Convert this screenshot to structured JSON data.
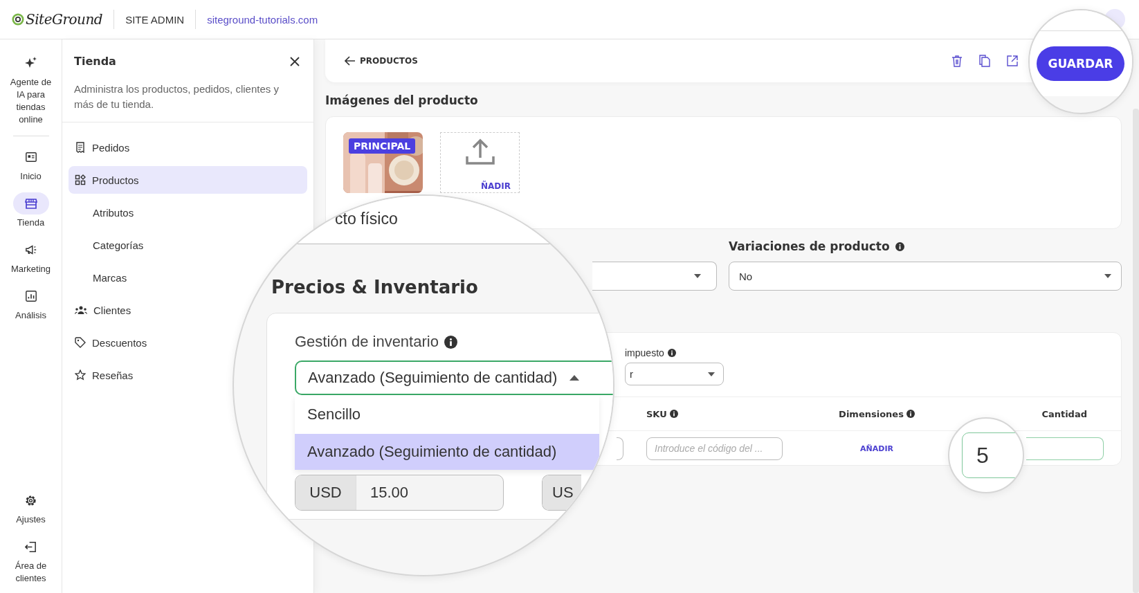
{
  "topbar": {
    "logo": "SiteGround",
    "section": "SITE ADMIN",
    "domain": "siteground-tutorials.com"
  },
  "rail": {
    "items": [
      {
        "label": "Agente de IA para tiendas online",
        "selected": false
      },
      {
        "label": "Inicio",
        "selected": false
      },
      {
        "label": "Tienda",
        "selected": true
      },
      {
        "label": "Marketing",
        "selected": false
      },
      {
        "label": "Análisis",
        "selected": false
      }
    ],
    "bottom": [
      {
        "label": "Ajustes",
        "selected": false
      },
      {
        "label": "Área de clientes",
        "selected": false
      }
    ]
  },
  "panel": {
    "title": "Tienda",
    "description": "Administra los productos, pedidos, clientes y más de tu tienda.",
    "items": [
      {
        "label": "Pedidos",
        "selected": false
      },
      {
        "label": "Productos",
        "selected": true,
        "children": [
          {
            "label": "Atributos",
            "selected": false
          },
          {
            "label": "Categorías",
            "selected": false
          },
          {
            "label": "Marcas",
            "selected": false
          }
        ]
      },
      {
        "label": "Clientes",
        "selected": false
      },
      {
        "label": "Descuentos",
        "selected": false
      },
      {
        "label": "Reseñas",
        "selected": false
      }
    ]
  },
  "header": {
    "back": "PRODUCTOS",
    "save": "GUARDAR"
  },
  "images": {
    "title": "Imágenes del producto",
    "badge": "PRINCIPAL",
    "upload": "ÑADIR"
  },
  "variations": {
    "label": "Variaciones de producto",
    "value": "No"
  },
  "pricing": {
    "tax_label": "impuesto",
    "tax_value": "r",
    "columns": [
      "SKU",
      "Dimensiones",
      "Cantidad"
    ],
    "sku_placeholder": "Introduce el código del ...",
    "dimensions_link": "AÑADIR"
  },
  "magnifier": {
    "product_type_value": "cto físico",
    "title": "Precios & Inventario",
    "inventory_label": "Gestión de inventario",
    "inventory_value": "Avanzado (Seguimiento de cantidad)",
    "options": [
      {
        "label": "Sencillo",
        "selected": false
      },
      {
        "label": "Avanzado (Seguimiento de cantidad)",
        "selected": true
      }
    ],
    "price_currency": "USD",
    "price_value": "15.00",
    "price2_currency": "US",
    "quantity_value": "5"
  }
}
